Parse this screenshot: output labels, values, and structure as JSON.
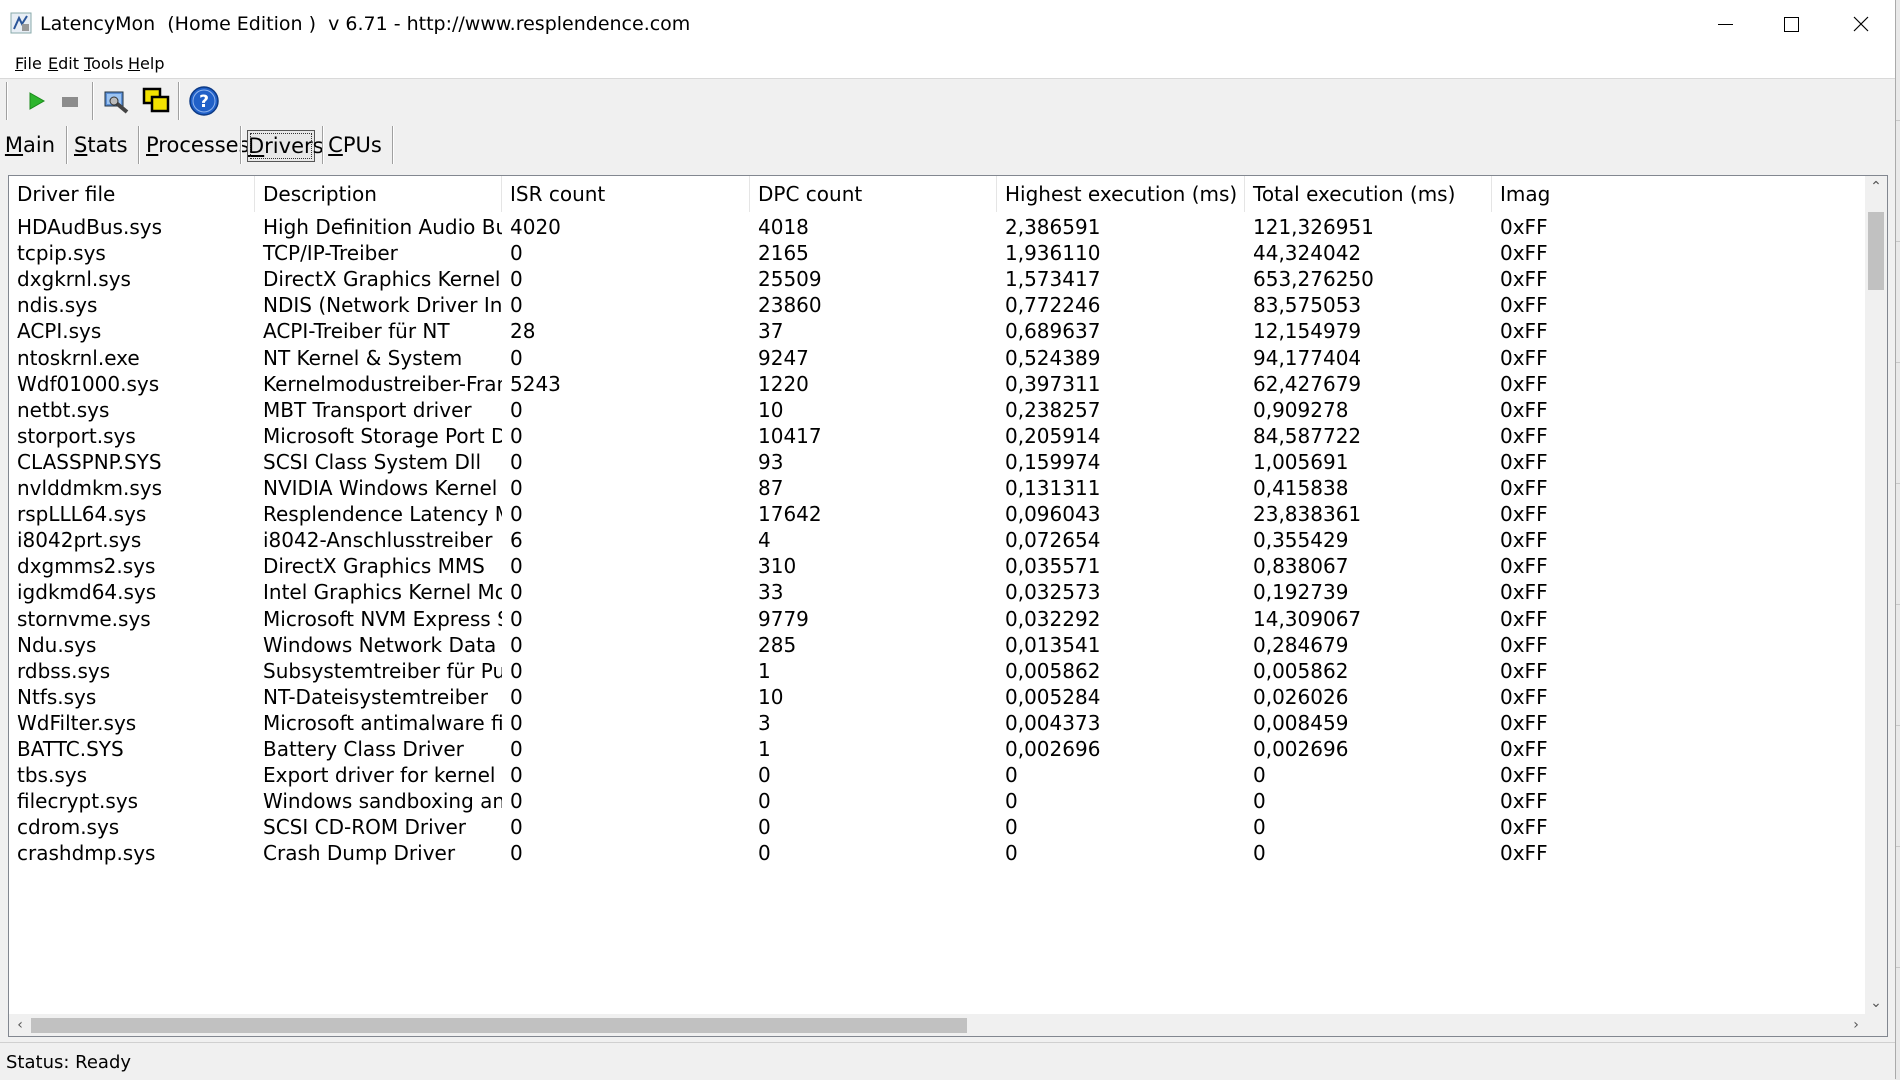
{
  "window": {
    "title": "LatencyMon  (Home Edition )  v 6.71 - http://www.resplendence.com"
  },
  "menu": {
    "items": [
      {
        "label_u": "F",
        "label_rest": "ile"
      },
      {
        "label_u": "E",
        "label_rest": "dit"
      },
      {
        "label_u": "T",
        "label_rest": "ools"
      },
      {
        "label_u": "H",
        "label_rest": "elp"
      }
    ]
  },
  "toolbar": {
    "icons": [
      "play-icon",
      "stop-icon",
      "tools-icon",
      "windows-icon",
      "help-icon"
    ],
    "play_color": "#2db52d",
    "help_color": "#2060c8"
  },
  "tabs": [
    {
      "label_u": "M",
      "label_rest": "ain"
    },
    {
      "label_u": "S",
      "label_rest": "tats"
    },
    {
      "label_u": "P",
      "label_rest": "rocesses"
    },
    {
      "label_u": "D",
      "label_rest": "rivers"
    },
    {
      "label_u": "C",
      "label_rest": "PUs"
    }
  ],
  "active_tab": "Drivers",
  "columns": [
    "Driver file",
    "Description",
    "ISR count",
    "DPC count",
    "Highest execution (ms)",
    "Total execution (ms)",
    "Imag"
  ],
  "rows": [
    [
      "HDAudBus.sys",
      "High Definition Audio Bus Dri...",
      "4020",
      "4018",
      "2,386591",
      "121,326951",
      "0xFF"
    ],
    [
      "tcpip.sys",
      "TCP/IP-Treiber",
      "0",
      "2165",
      "1,936110",
      "44,324042",
      "0xFF"
    ],
    [
      "dxgkrnl.sys",
      "DirectX Graphics Kernel",
      "0",
      "25509",
      "1,573417",
      "653,276250",
      "0xFF"
    ],
    [
      "ndis.sys",
      "NDIS (Network Driver Interf...",
      "0",
      "23860",
      "0,772246",
      "83,575053",
      "0xFF"
    ],
    [
      "ACPI.sys",
      "ACPI-Treiber für NT",
      "28",
      "37",
      "0,689637",
      "12,154979",
      "0xFF"
    ],
    [
      "ntoskrnl.exe",
      "NT Kernel & System",
      "0",
      "9247",
      "0,524389",
      "94,177404",
      "0xFF"
    ],
    [
      "Wdf01000.sys",
      "Kernelmodustreiber-Framew...",
      "5243",
      "1220",
      "0,397311",
      "62,427679",
      "0xFF"
    ],
    [
      "netbt.sys",
      "MBT Transport driver",
      "0",
      "10",
      "0,238257",
      "0,909278",
      "0xFF"
    ],
    [
      "storport.sys",
      "Microsoft Storage Port Driver",
      "0",
      "10417",
      "0,205914",
      "84,587722",
      "0xFF"
    ],
    [
      "CLASSPNP.SYS",
      "SCSI Class System Dll",
      "0",
      "93",
      "0,159974",
      "1,005691",
      "0xFF"
    ],
    [
      "nvlddmkm.sys",
      "NVIDIA Windows Kernel Mod...",
      "0",
      "87",
      "0,131311",
      "0,415838",
      "0xFF"
    ],
    [
      "rspLLL64.sys",
      "Resplendence Latency Monit...",
      "0",
      "17642",
      "0,096043",
      "23,838361",
      "0xFF"
    ],
    [
      "i8042prt.sys",
      "i8042-Anschlusstreiber",
      "6",
      "4",
      "0,072654",
      "0,355429",
      "0xFF"
    ],
    [
      "dxgmms2.sys",
      "DirectX Graphics MMS",
      "0",
      "310",
      "0,035571",
      "0,838067",
      "0xFF"
    ],
    [
      "igdkmd64.sys",
      "Intel Graphics Kernel Mode D...",
      "0",
      "33",
      "0,032573",
      "0,192739",
      "0xFF"
    ],
    [
      "stornvme.sys",
      "Microsoft NVM Express Stor...",
      "0",
      "9779",
      "0,032292",
      "14,309067",
      "0xFF"
    ],
    [
      "Ndu.sys",
      "Windows Network Data Usa...",
      "0",
      "285",
      "0,013541",
      "0,284679",
      "0xFF"
    ],
    [
      "rdbss.sys",
      "Subsystemtreiber für Puffer...",
      "0",
      "1",
      "0,005862",
      "0,005862",
      "0xFF"
    ],
    [
      "Ntfs.sys",
      "NT-Dateisystemtreiber",
      "0",
      "10",
      "0,005284",
      "0,026026",
      "0xFF"
    ],
    [
      "WdFilter.sys",
      "Microsoft antimalware file sys...",
      "0",
      "3",
      "0,004373",
      "0,008459",
      "0xFF"
    ],
    [
      "BATTC.SYS",
      "Battery Class Driver",
      "0",
      "1",
      "0,002696",
      "0,002696",
      "0xFF"
    ],
    [
      "tbs.sys",
      "Export driver for kernel mod...",
      "0",
      "0",
      "0",
      "0",
      "0xFF"
    ],
    [
      "filecrypt.sys",
      "Windows sandboxing and e...",
      "0",
      "0",
      "0",
      "0",
      "0xFF"
    ],
    [
      "cdrom.sys",
      "SCSI CD-ROM Driver",
      "0",
      "0",
      "0",
      "0",
      "0xFF"
    ],
    [
      "crashdmp.sys",
      "Crash Dump Driver",
      "0",
      "0",
      "0",
      "0",
      "0xFF"
    ]
  ],
  "status": {
    "text": "Status: Ready"
  }
}
